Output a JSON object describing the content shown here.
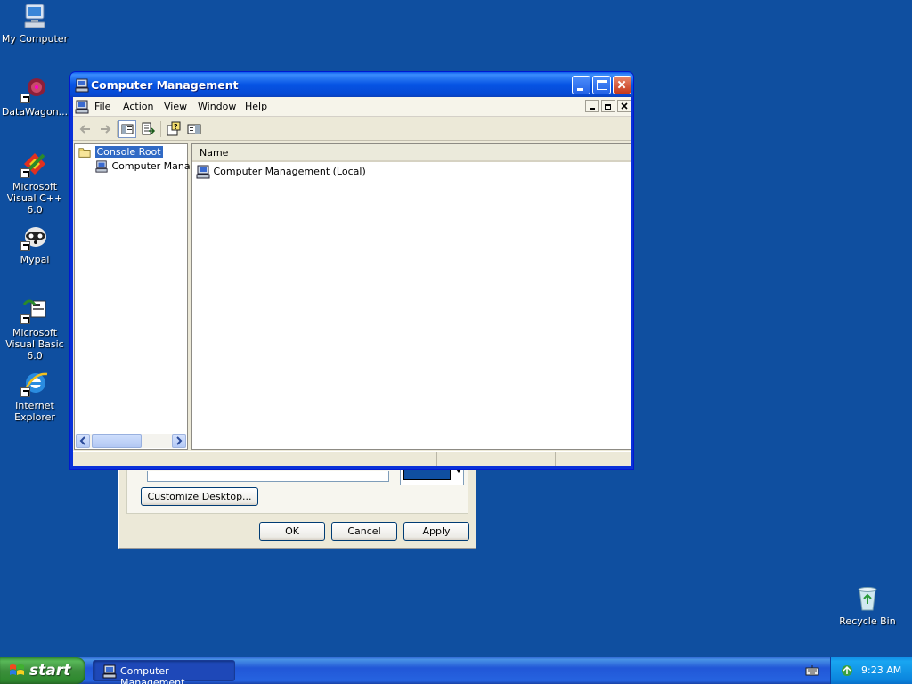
{
  "desktop": {
    "icons": [
      {
        "label": "My Computer",
        "icon": "my-computer-icon"
      },
      {
        "label": "DataWagon...",
        "icon": "datawagon-icon"
      },
      {
        "label": "Microsoft Visual C++ 6.0",
        "icon": "visual-cpp-icon"
      },
      {
        "label": "Mypal",
        "icon": "mypal-icon"
      },
      {
        "label": "Microsoft Visual Basic 6.0",
        "icon": "visual-basic-icon"
      },
      {
        "label": "Internet Explorer",
        "icon": "internet-explorer-icon"
      },
      {
        "label": "Recycle Bin",
        "icon": "recycle-bin-icon"
      }
    ]
  },
  "background_dialog": {
    "customize_label": "Customize Desktop...",
    "ok_label": "OK",
    "cancel_label": "Cancel",
    "apply_label": "Apply",
    "color_swatch": "#0f4fa0"
  },
  "window": {
    "title": "Computer Management",
    "menu": [
      "File",
      "Action",
      "View",
      "Window",
      "Help"
    ],
    "toolbar": {
      "back": "back-arrow-icon",
      "forward": "forward-arrow-icon",
      "show_hide_tree": "show-hide-console-tree-icon",
      "export_list": "export-list-icon",
      "help": "help-icon",
      "show_hide_action": "show-hide-action-pane-icon"
    },
    "tree": {
      "root": "Console Root",
      "child": "Computer Manag"
    },
    "list": {
      "columns": [
        "Name"
      ],
      "rows": [
        {
          "name": "Computer Management (Local)"
        }
      ]
    }
  },
  "taskbar": {
    "start_label": "start",
    "task_button_label": "Computer Management",
    "clock": "9:23 AM"
  },
  "colors": {
    "desktop": "#0f4fa0",
    "titlebar": "#0654e4",
    "selection": "#316ac5",
    "start": "#3c8f3c"
  }
}
